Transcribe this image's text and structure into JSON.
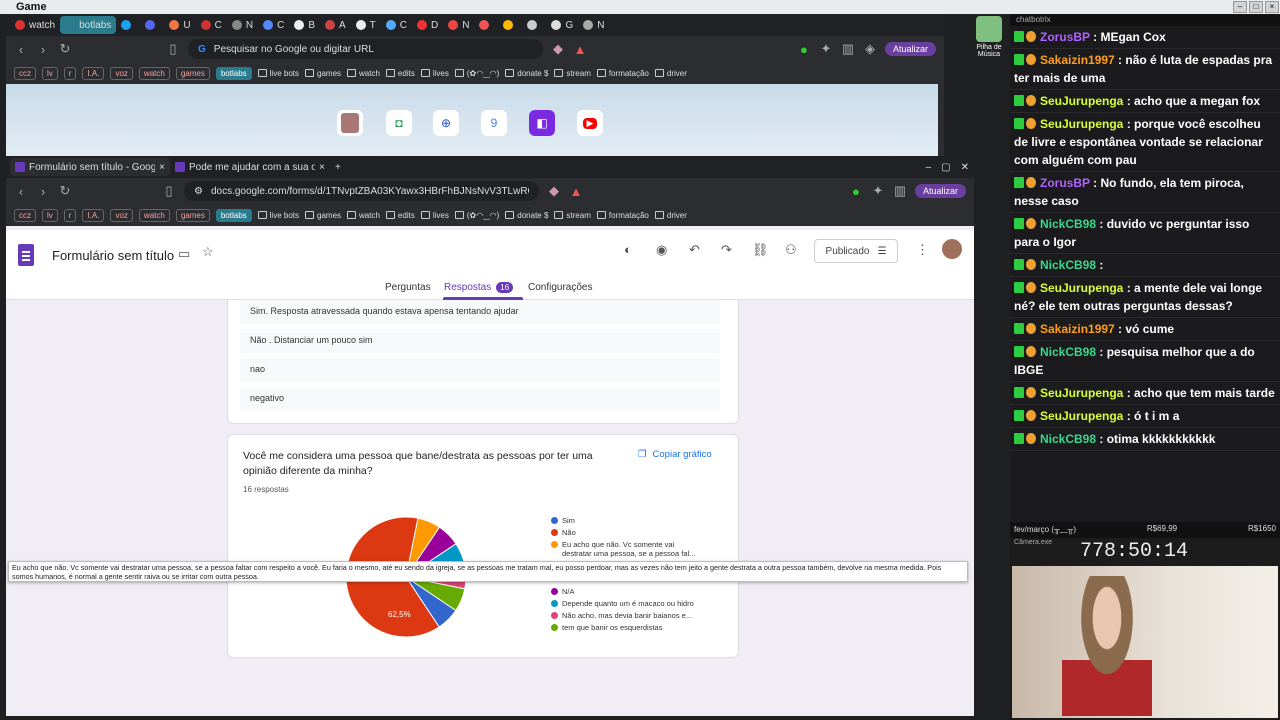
{
  "outer_window": {
    "title": "Game"
  },
  "back_browser": {
    "tabs": [
      {
        "label": "watch",
        "color": "#d33"
      },
      {
        "label": "botlabs",
        "color": "#2a7c8c"
      },
      {
        "label": "",
        "color": "#1da1f2"
      },
      {
        "label": "",
        "color": "#5865f2"
      },
      {
        "label": "U",
        "color": "#e74"
      },
      {
        "label": "C",
        "color": "#c33"
      },
      {
        "label": "N",
        "color": "#888"
      },
      {
        "label": "C",
        "color": "#58f"
      },
      {
        "label": "B",
        "color": "#eee"
      },
      {
        "label": "A",
        "color": "#c44"
      },
      {
        "label": "T",
        "color": "#eee"
      },
      {
        "label": "C",
        "color": "#5af"
      },
      {
        "label": "D",
        "color": "#e33"
      },
      {
        "label": "N",
        "color": "#e44"
      },
      {
        "label": "",
        "color": "#e55"
      },
      {
        "label": "",
        "color": "#fb0"
      },
      {
        "label": "",
        "color": "#ccc"
      },
      {
        "label": "G",
        "color": "#ddd"
      },
      {
        "label": "N",
        "color": "#aaa"
      }
    ],
    "omnibox_placeholder": "Pesquisar no Google ou digitar URL",
    "update_button": "Atualizar"
  },
  "bookmarks": {
    "chips": [
      "ccz",
      "lv",
      "r",
      "I.A.",
      "voz",
      "watch",
      "games",
      "botlabs"
    ],
    "items": [
      "live bots",
      "games",
      "watch",
      "edits",
      "lives",
      "(✿◠‿◠)",
      "donate $",
      "stream",
      "formatação",
      "driver"
    ]
  },
  "front_browser": {
    "tabs": [
      {
        "label": "Formulário sem título - Google F",
        "active": true
      },
      {
        "label": "Pode me ajudar com a sua opinião?",
        "active": false
      }
    ],
    "url": "docs.google.com/forms/d/1TNvptZBA03KYawx3HBrFhBJNsNvV3TLwROB...",
    "update_button": "Atualizar"
  },
  "form": {
    "title": "Formulário sem título",
    "publish_button": "Publicado",
    "tabs": [
      "Perguntas",
      "Respostas",
      "Configurações"
    ],
    "responses_badge": "16",
    "prev_answers": [
      "Sim. Resposta atravessada quando estava apensa tentando ajudar",
      "Não . Distanciar um pouco sim",
      "nao",
      "negativo"
    ],
    "question": {
      "title": "Você me considera uma pessoa que bane/destrata as pessoas por ter uma opinião diferente da minha?",
      "count": "16 respostas",
      "copy_label": "Copiar gráfico",
      "slice_label": "62,5%"
    },
    "legend": [
      {
        "label": "Sim",
        "color": "#3366cc"
      },
      {
        "label": "Não",
        "color": "#dc3912"
      },
      {
        "label": "Eu acho que não. Vc somente vai destratar uma pessoa, se a pessoa fal...",
        "color": "#ff9900"
      },
      {
        "label": "N/A",
        "color": "#990099"
      },
      {
        "label": "Depende quanto um é macaco ou hidro",
        "color": "#0099c6"
      },
      {
        "label": "Não acho, mas devia banir baianos e...",
        "color": "#dd4477"
      },
      {
        "label": "tem que banir os esquerdistas",
        "color": "#66aa00"
      }
    ],
    "tooltip": "Eu acho que não. Vc somente vai destratar uma pessoa, se a pessoa faltar com respeito a você. Eu faria o mesmo, até eu sendo da igreja, se as pessoas me tratam mal, eu posso perdoar, mas as vezes não tem jeito a gente destrata a outra pessoa também, devolve na mesma medida. Pois somos humanos, é normal a gente sentir raiva ou se irritar com outra pessoa."
  },
  "chart_data": {
    "type": "pie",
    "title": "Você me considera uma pessoa que bane/destrata as pessoas por ter uma opinião diferente da minha?",
    "categories": [
      "Sim",
      "Não",
      "Eu acho que não...",
      "N/A",
      "Depende quanto um é macaco ou hidro",
      "Não acho, mas devia banir baianos e...",
      "tem que banir os esquerdistas"
    ],
    "values": [
      6.25,
      62.5,
      6.25,
      6.25,
      6.25,
      6.25,
      6.25
    ]
  },
  "streamer_icon_label": "Pilha de Música",
  "chat": {
    "title": "chatbotrix",
    "messages": [
      {
        "user": "ZorusBP",
        "color": "#b061ff",
        "text": "MEgan Cox"
      },
      {
        "user": "Sakaizin1997",
        "color": "#ff9f1a",
        "text": "não é luta de espadas pra ter mais de uma"
      },
      {
        "user": "SeuJurupenga",
        "color": "#d7ff35",
        "text": "acho que a megan fox"
      },
      {
        "user": "SeuJurupenga",
        "color": "#d7ff35",
        "text": "porque você escolheu de livre e espontânea vontade se relacionar com alguém com pau"
      },
      {
        "user": "ZorusBP",
        "color": "#b061ff",
        "text": "No fundo, ela tem piroca, nesse caso"
      },
      {
        "user": "NickCB98",
        "color": "#3cd68c",
        "text": "duvido vc perguntar isso para o Igor"
      },
      {
        "user": "NickCB98",
        "color": "#3cd68c",
        "text": ""
      },
      {
        "user": "SeuJurupenga",
        "color": "#d7ff35",
        "text": "a mente dele vai longe né? ele tem outras perguntas dessas?"
      },
      {
        "user": "Sakaizin1997",
        "color": "#ff9f1a",
        "text": "vó cume"
      },
      {
        "user": "NickCB98",
        "color": "#3cd68c",
        "text": "pesquisa melhor que a do IBGE"
      },
      {
        "user": "SeuJurupenga",
        "color": "#d7ff35",
        "text": "acho que tem mais tarde"
      },
      {
        "user": "SeuJurupenga",
        "color": "#d7ff35",
        "text": "ó t i m a"
      },
      {
        "user": "NickCB98",
        "color": "#3cd68c",
        "text": "otima kkkkkkkkkkk"
      }
    ]
  },
  "overlay": {
    "goal_label": "fev/março (╥﹏╥)",
    "goal_current": "R$69,99",
    "goal_target": "R$1650",
    "camera_label": "Câmera.exe",
    "timer": "778:50:14"
  }
}
